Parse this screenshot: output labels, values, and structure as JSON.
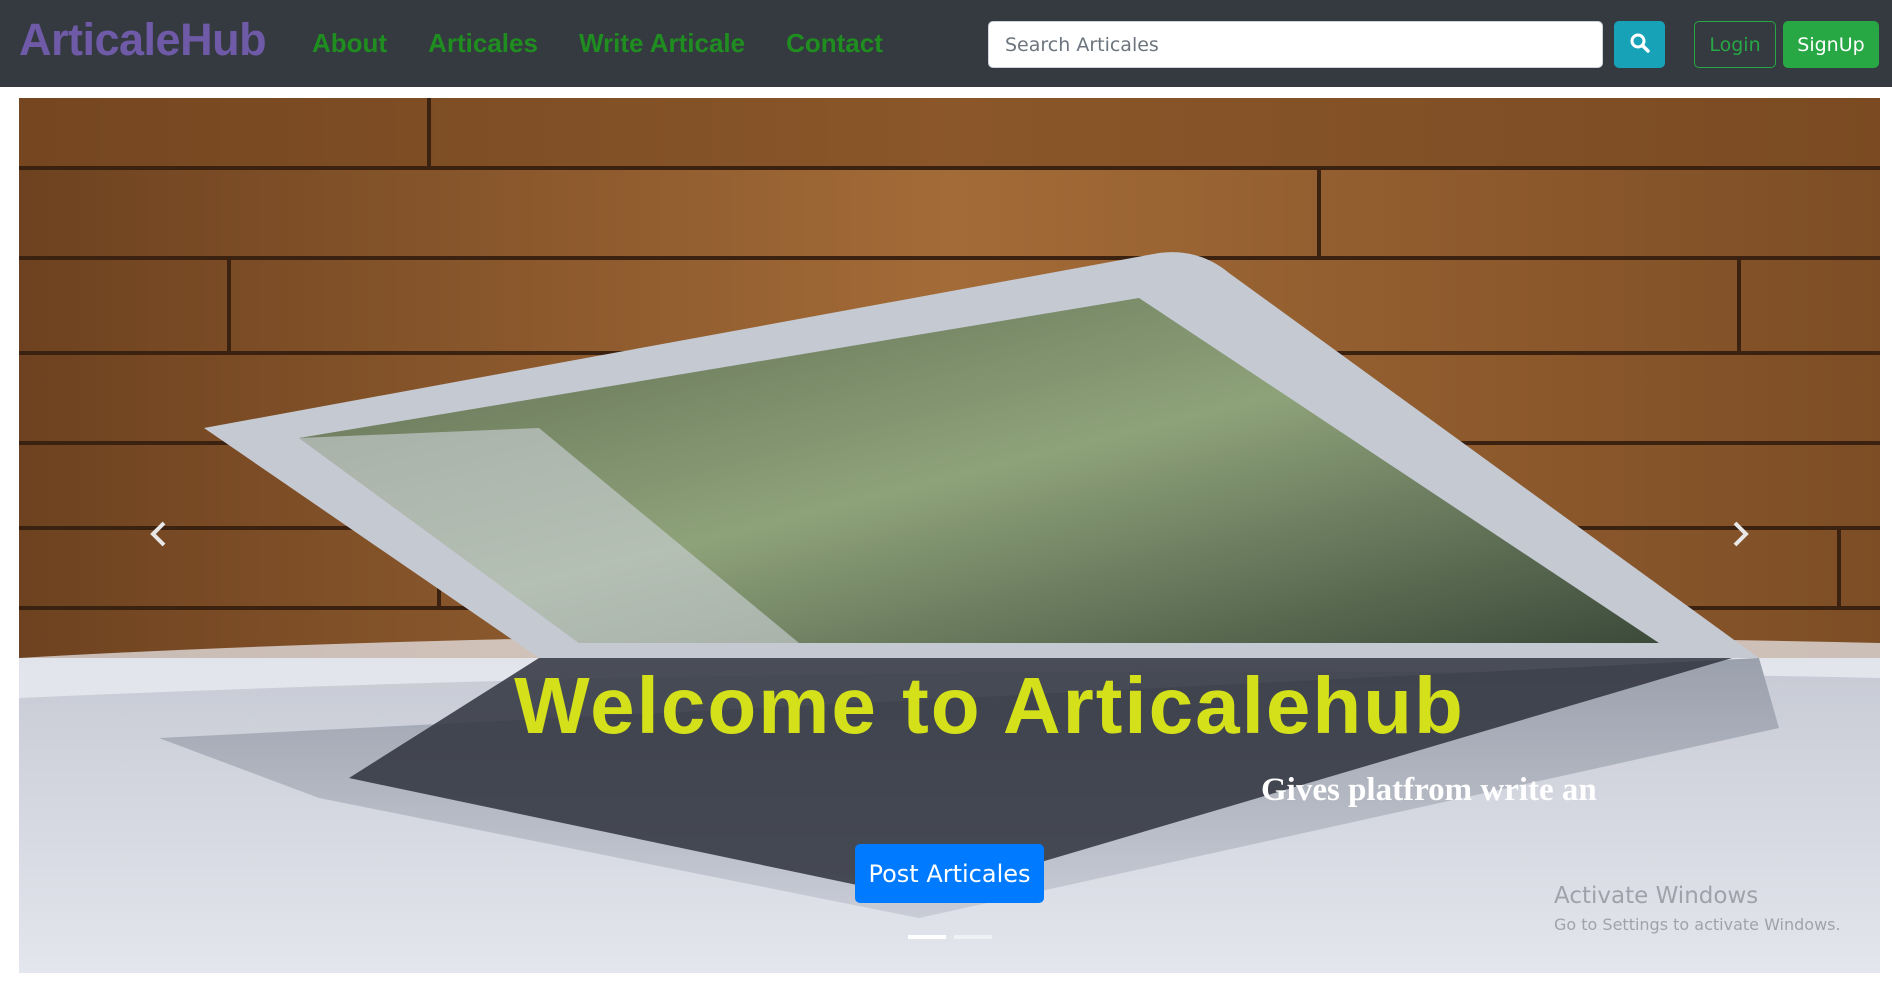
{
  "brand": "ArticaleHub",
  "nav": {
    "links": [
      "About",
      "Articales",
      "Write Articale",
      "Contact"
    ]
  },
  "search": {
    "placeholder": "Search Articales",
    "button_icon": "search-icon"
  },
  "auth": {
    "login_label": "Login",
    "signup_label": "SignUp"
  },
  "hero": {
    "title": "Welcome to Articalehub",
    "subtitle": "Gives platfrom write an",
    "cta_label": "Post Articales",
    "prev_icon": "chevron-left-icon",
    "next_icon": "chevron-right-icon",
    "slides": 2,
    "active_slide": 1
  },
  "watermark": {
    "title": "Activate Windows",
    "subtitle": "Go to Settings to activate Windows."
  },
  "colors": {
    "navbar_bg": "#343a40",
    "brand": "#6f5aa8",
    "nav_link": "#1f8d1f",
    "search_button": "#17a2b8",
    "success": "#28a745",
    "primary": "#007bff",
    "hero_title": "#d4e01a"
  }
}
